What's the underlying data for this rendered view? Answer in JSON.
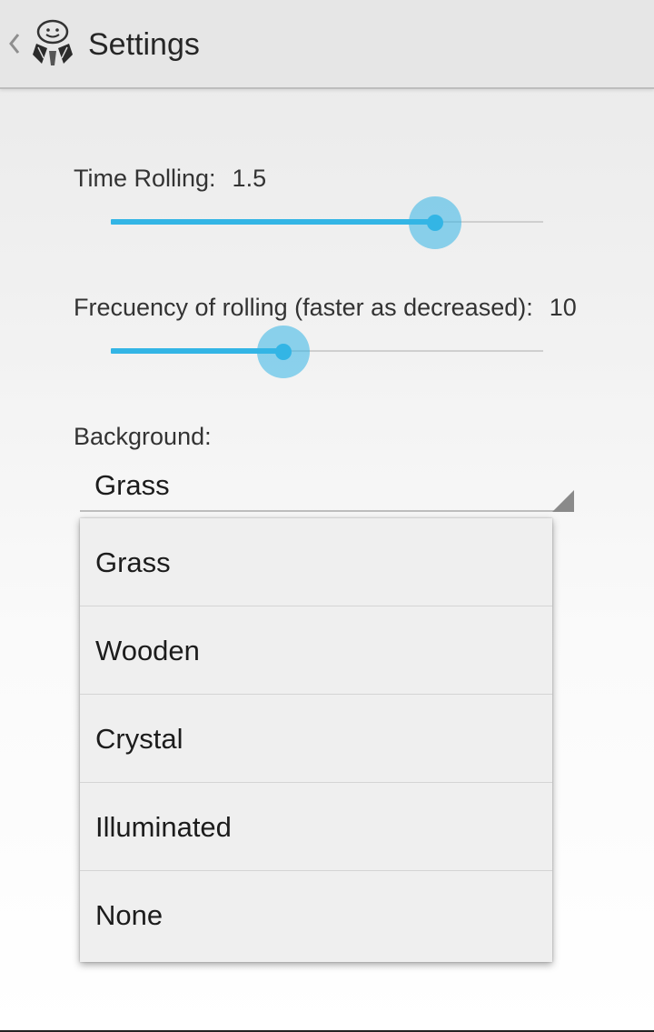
{
  "action_bar": {
    "title": "Settings",
    "up_icon": "chevron-left-icon",
    "app_icon": "app-logo-icon"
  },
  "preferences": {
    "time_rolling": {
      "label": "Time Rolling:",
      "value": "1.5",
      "slider_fraction": 0.75
    },
    "frequency": {
      "label": "Frecuency of rolling (faster as decreased):",
      "value": "10",
      "slider_fraction": 0.4
    },
    "background": {
      "label": "Background:",
      "selected": "Grass",
      "options": [
        "Grass",
        "Wooden",
        "Crystal",
        "Illuminated",
        "None"
      ]
    }
  },
  "colors": {
    "accent": "#33b5e5",
    "action_bar_bg": "#e6e6e6"
  }
}
